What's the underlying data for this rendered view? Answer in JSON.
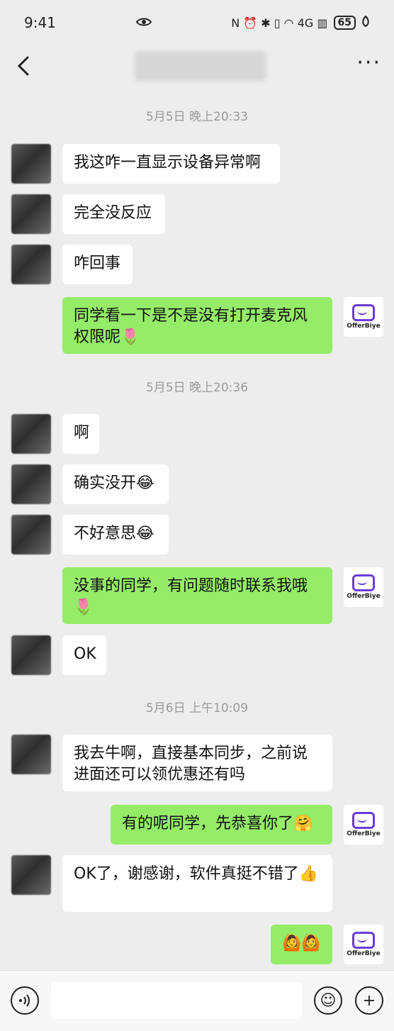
{
  "status": {
    "time": "9:41",
    "eye_icon": "eye-icon",
    "icons": "N ⏰ ✱ ▯ ◠ 4G ▥",
    "battery": "65",
    "leaf_icon": "leaf-icon"
  },
  "nav": {
    "back_icon": "chevron-left",
    "more_icon": "ellipsis",
    "more_label": "···"
  },
  "timestamps": [
    "5月5日 晚上20:33",
    "5月5日 晚上20:36",
    "5月6日 上午10:09"
  ],
  "messages": [
    {
      "side": "left",
      "text": "我这咋一直显示设备异常啊"
    },
    {
      "side": "left",
      "text": "完全没反应"
    },
    {
      "side": "left",
      "text": "咋回事"
    },
    {
      "side": "right",
      "text": "同学看一下是不是没有打开麦克风权限呢🌷"
    },
    {
      "side": "left",
      "text": "啊"
    },
    {
      "side": "left",
      "text": "确实没开😂"
    },
    {
      "side": "left",
      "text": "不好意思😂"
    },
    {
      "side": "right",
      "text": "没事的同学，有问题随时联系我哦🌷"
    },
    {
      "side": "left",
      "text": "OK"
    },
    {
      "side": "left",
      "text": "我去牛啊，直接基本同步，之前说进面还可以领优惠还有吗"
    },
    {
      "side": "right",
      "text": "有的呢同学，先恭喜你了🤗"
    },
    {
      "side": "left",
      "text": "OK了，谢感谢，软件真挺不错了👍"
    },
    {
      "side": "right",
      "text": "🙆🙆"
    }
  ],
  "logo": {
    "text": "OfferBiye"
  },
  "input": {
    "placeholder": "",
    "voice_icon": "voice-icon",
    "emoji_icon": "emoji-icon",
    "plus_icon": "plus-icon",
    "emoji_glyph": "☺",
    "plus_glyph": "+"
  }
}
